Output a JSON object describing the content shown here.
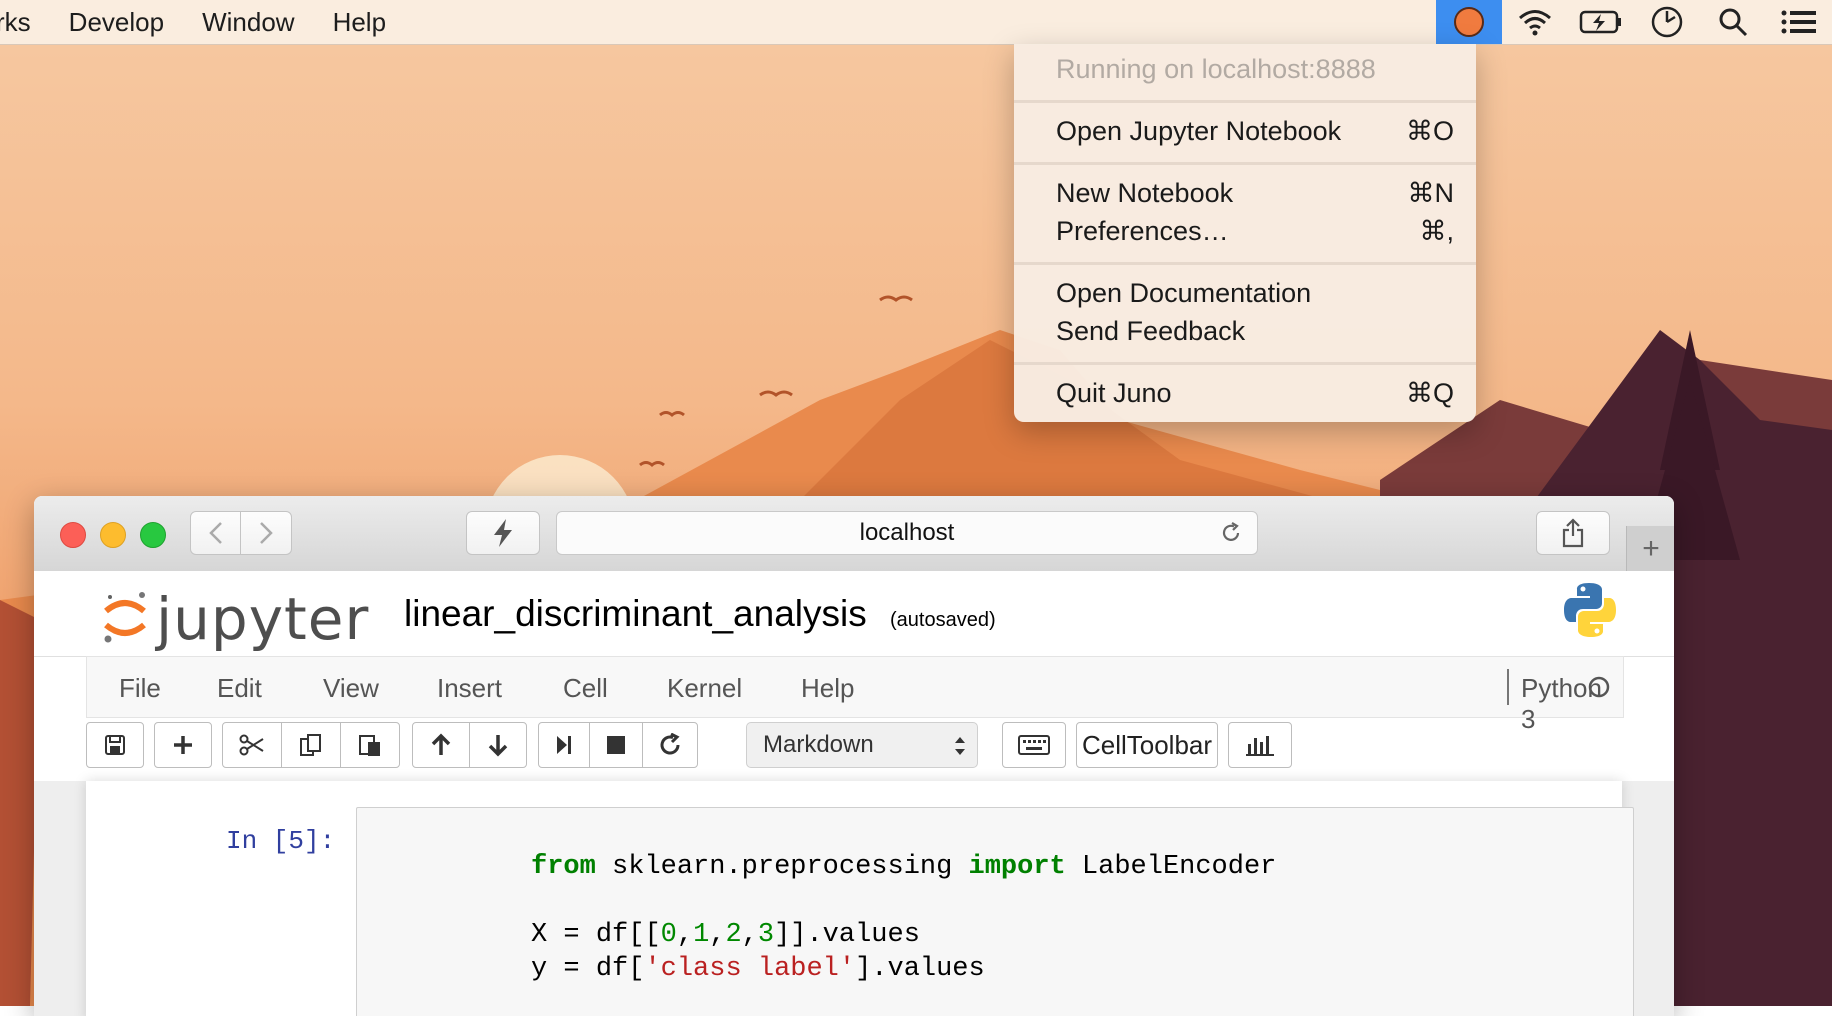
{
  "menubar": {
    "items": [
      "rks",
      "Develop",
      "Window",
      "Help"
    ]
  },
  "status_icons": [
    "juno-app-icon",
    "wifi-icon",
    "battery-charging-icon",
    "clock-icon",
    "spotlight-search-icon",
    "notification-center-icon"
  ],
  "dropdown": {
    "running": "Running on localhost:8888",
    "items": [
      {
        "label": "Open Jupyter Notebook",
        "shortcut": "⌘O"
      },
      {
        "label": "New Notebook",
        "shortcut": "⌘N"
      },
      {
        "label": "Preferences…",
        "shortcut": "⌘,"
      },
      {
        "label": "Open Documentation",
        "shortcut": ""
      },
      {
        "label": "Send Feedback",
        "shortcut": ""
      },
      {
        "label": "Quit Juno",
        "shortcut": "⌘Q"
      }
    ]
  },
  "browser": {
    "url": "localhost",
    "new_tab": "+"
  },
  "jupyter": {
    "logo_text": "jupyter",
    "notebook_title": "linear_discriminant_analysis",
    "autosave": "(autosaved)",
    "menu": [
      "File",
      "Edit",
      "View",
      "Insert",
      "Cell",
      "Kernel",
      "Help"
    ],
    "kernel": "Python 3",
    "cell_type": "Markdown",
    "celltoolbar": "CellToolbar"
  },
  "cell": {
    "prompt": "In [5]:",
    "code": [
      [
        "kw:from",
        "txt: sklearn.preprocessing ",
        "kw:import",
        "txt: LabelEncoder"
      ],
      [],
      [
        "txt:X = df[[",
        "num:0",
        "txt:,",
        "num:1",
        "txt:,",
        "num:2",
        "txt:,",
        "num:3",
        "txt:]].values"
      ],
      [
        "txt:y = df[",
        "str:'class label'",
        "txt:].values"
      ]
    ]
  },
  "colors": {
    "accent_blue": "#3d8ef0",
    "prompt_blue": "#303F9F",
    "keyword_green": "#008000",
    "string_red": "#BA2121"
  }
}
